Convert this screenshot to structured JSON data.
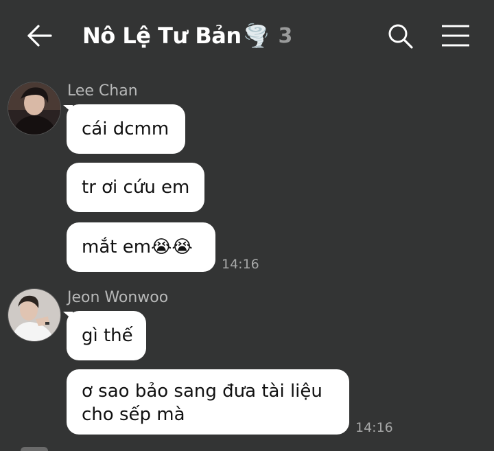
{
  "header": {
    "back_icon": "arrow-left-icon",
    "title": "Nô Lệ Tư Bản",
    "title_emoji": "🌪️",
    "member_count": "3",
    "search_icon": "search-icon",
    "menu_icon": "hamburger-menu-icon"
  },
  "messages": [
    {
      "sender": "Lee Chan",
      "bubbles": [
        "cái dcmm",
        "tr ơi cứu em",
        "mắt em😭😭"
      ],
      "time": "14:16"
    },
    {
      "sender": "Jeon Wonwoo",
      "bubbles": [
        "gì thế",
        "ơ sao bảo sang đưa tài liệu cho sếp mà"
      ],
      "time": "14:16"
    }
  ],
  "colors": {
    "background": "#333434",
    "bubble": "#ffffff",
    "text_primary": "#ffffff",
    "text_muted": "#b7b8b8"
  }
}
